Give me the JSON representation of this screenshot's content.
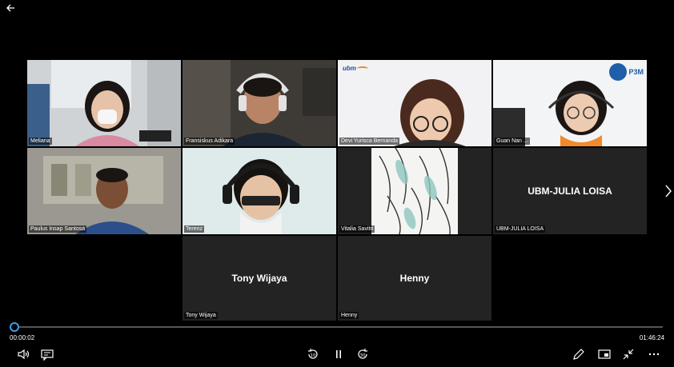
{
  "time": {
    "elapsed": "00:00:02",
    "total": "01:46:24"
  },
  "participants": [
    {
      "name": "Meliana",
      "type": "video"
    },
    {
      "name": "Fransiskus Adikara",
      "type": "video"
    },
    {
      "name": "Devi Yurisca Bernanda",
      "type": "video"
    },
    {
      "name": "Guan Nan ...",
      "type": "video"
    },
    {
      "name": "Paulus Insap Santosa",
      "type": "video"
    },
    {
      "name": "Terenz",
      "type": "video"
    },
    {
      "name": "Vitalia Savitri",
      "type": "image"
    },
    {
      "name": "UBM-JULIA LOISA",
      "type": "name-card",
      "display": "UBM-JULIA LOISA"
    },
    {
      "name": "Tony Wijaya",
      "type": "name-card",
      "display": "Tony Wijaya"
    },
    {
      "name": "Henny",
      "type": "name-card",
      "display": "Henny"
    }
  ],
  "logos": {
    "ubm": "ubm",
    "p3m": "P3M"
  },
  "colors": {
    "accent": "#3b9fe8",
    "tile_bg": "#232323",
    "background": "#000000"
  },
  "icons": {
    "back": "arrow-left-icon",
    "volume": "volume-icon",
    "captions": "captions-icon",
    "rewind": "rewind-10-icon",
    "pause": "pause-icon",
    "forward": "forward-30-icon",
    "pen": "pen-icon",
    "miniplayer": "miniplayer-icon",
    "collapse": "collapse-icon",
    "more": "more-icon"
  },
  "controls": {
    "rewind_seconds": "10",
    "forward_seconds": "30"
  },
  "playback": {
    "progress": 0.0003
  }
}
